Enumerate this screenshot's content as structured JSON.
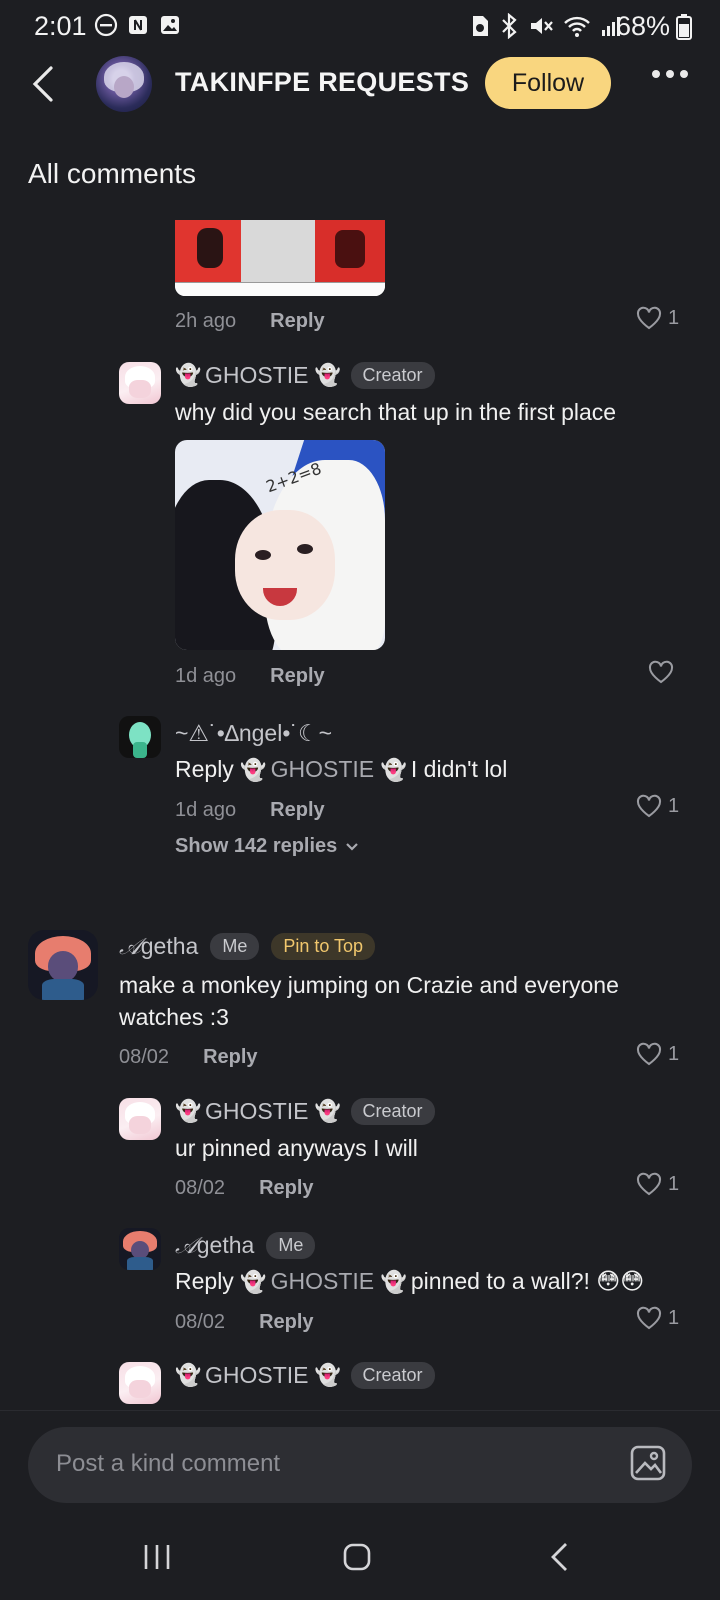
{
  "status_bar": {
    "time": "2:01",
    "battery": "68%",
    "icons_left": [
      "dnd-icon",
      "nfc-icon",
      "gallery-icon"
    ],
    "icons_right": [
      "sim-icon",
      "bluetooth-icon",
      "mute-icon",
      "wifi-icon",
      "signal-icon"
    ]
  },
  "header": {
    "title": "TAKINFPE REQUESTS",
    "follow_label": "Follow"
  },
  "section_title": "All comments",
  "comments": {
    "c0": {
      "time": "2h ago",
      "reply": "Reply",
      "likes": "1"
    },
    "c1": {
      "author": "GHOSTIE",
      "badge": "Creator",
      "text": "why did you search that up in the first place",
      "image_math": "2+2=8",
      "time": "1d ago",
      "reply": "Reply"
    },
    "c2": {
      "author": "~⚠˙•∆ngel•˙☾~",
      "text_prefix": "Reply",
      "ref": "GHOSTIE",
      "text": "I didn't lol",
      "time": "1d ago",
      "reply": "Reply",
      "likes": "1",
      "show_replies": "Show 142 replies"
    },
    "c3": {
      "author_initial": "𝒜",
      "author": "getha",
      "badge_me": "Me",
      "badge_pin": "Pin to Top",
      "text": "make a monkey jumping on Crazie and everyone watches :3",
      "time": "08/02",
      "reply": "Reply",
      "likes": "1"
    },
    "c4": {
      "author": "GHOSTIE",
      "badge": "Creator",
      "text": "ur pinned anyways I will",
      "time": "08/02",
      "reply": "Reply",
      "likes": "1"
    },
    "c5": {
      "author_initial": "𝒜",
      "author": "getha",
      "badge_me": "Me",
      "text_prefix": "Reply",
      "ref": "GHOSTIE",
      "text": "pinned to a wall?! 😳😳",
      "time": "08/02",
      "reply": "Reply",
      "likes": "1"
    },
    "c6": {
      "author": "GHOSTIE",
      "badge": "Creator"
    }
  },
  "ghost_emoji": "👻",
  "composer": {
    "placeholder": "Post a kind comment"
  },
  "colors": {
    "background": "#1d1e22",
    "follow": "#f9d67f",
    "pin_badge_text": "#f1c76d"
  }
}
